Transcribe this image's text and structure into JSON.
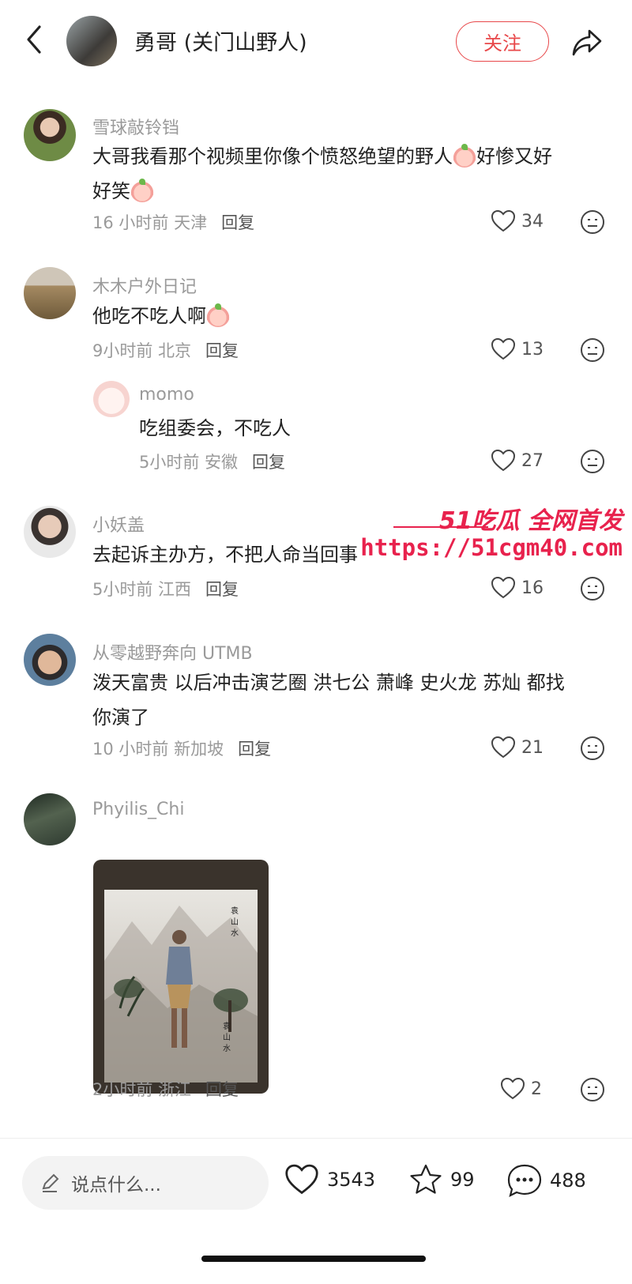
{
  "header": {
    "title": "勇哥 (关门山野人)",
    "follow_label": "关注"
  },
  "comments": [
    {
      "user": "雪球敲铃铛",
      "text_a": "大哥我看那个视频里你像个愤怒绝望的野人",
      "text_b": "好惨又好",
      "text_c": "好笑",
      "time": "16 小时前 天津",
      "reply": "回复",
      "likes": "34"
    },
    {
      "user": "木木户外日记",
      "text_a": "他吃不吃人啊",
      "time": "9小时前 北京",
      "reply": "回复",
      "likes": "13"
    },
    {
      "user": "momo",
      "text_a": "吃组委会，不吃人",
      "time": "5小时前 安徽",
      "reply": "回复",
      "likes": "27"
    },
    {
      "user": "小妖盖",
      "text_a": "去起诉主办方，不把人命当回事",
      "time": "5小时前 江西",
      "reply": "回复",
      "likes": "16"
    },
    {
      "user": "从零越野奔向 UTMB",
      "text_a": "泼天富贵 以后冲击演艺圈 洪七公 萧峰 史火龙 苏灿 都找",
      "text_b": "你演了",
      "time": "10 小时前 新加坡",
      "reply": "回复",
      "likes": "21"
    },
    {
      "user": "Phyilis_Chi",
      "time": "2小时前 浙江",
      "reply": "回复",
      "likes": "2"
    }
  ],
  "watermark": {
    "brand": "51吃瓜 全网首发",
    "url": "https://51cgm40.com"
  },
  "bottom": {
    "input_placeholder": "说点什么...",
    "likes": "3543",
    "stars": "99",
    "comments": "488"
  },
  "colors": {
    "accent": "#e8484a",
    "watermark": "#e8224d"
  }
}
